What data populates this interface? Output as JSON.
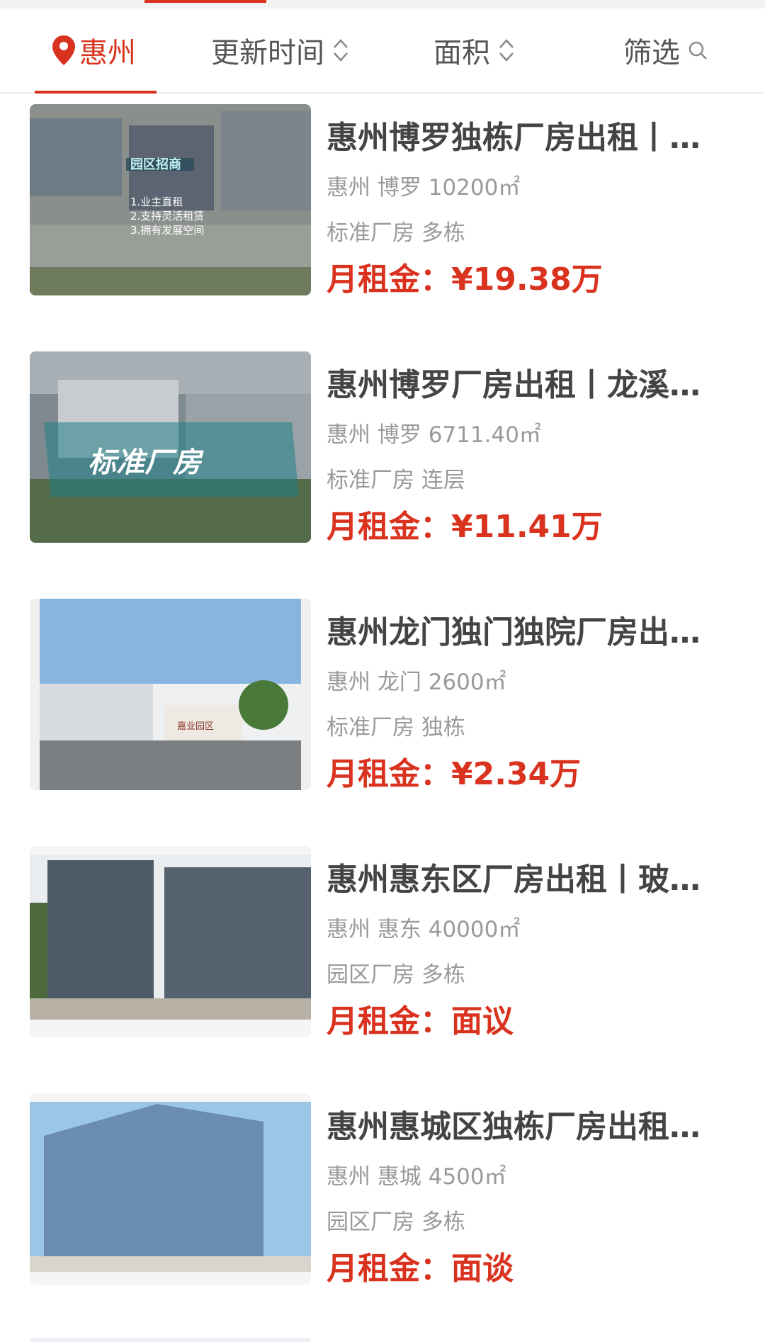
{
  "filter_bar": {
    "city": "惠州",
    "update_time": "更新时间",
    "area": "面积",
    "screen": "筛选"
  },
  "listings": [
    {
      "title": "惠州博罗独栋厂房出租丨…",
      "city": "惠州",
      "district": "博罗",
      "area": "10200㎡",
      "type": "标准厂房 多栋",
      "price_label": "月租金：",
      "price": "¥19.38万",
      "image_text": [
        "园区招商",
        "1.业主直租",
        "2.支持灵活租赁",
        "3.拥有发展空间"
      ]
    },
    {
      "title": "惠州博罗厂房出租丨龙溪…",
      "city": "惠州",
      "district": "博罗",
      "area": "6711.40㎡",
      "type": "标准厂房 连层",
      "price_label": "月租金：",
      "price": "¥11.41万",
      "image_text": [
        "标准厂房"
      ]
    },
    {
      "title": "惠州龙门独门独院厂房出…",
      "city": "惠州",
      "district": "龙门",
      "area": "2600㎡",
      "type": "标准厂房 独栋",
      "price_label": "月租金：",
      "price": "¥2.34万",
      "image_text": [
        "嘉业园区"
      ]
    },
    {
      "title": "惠州惠东区厂房出租丨玻…",
      "city": "惠州",
      "district": "惠东",
      "area": "40000㎡",
      "type": "园区厂房 多栋",
      "price_label": "月租金：",
      "price": "面议",
      "image_text": []
    },
    {
      "title": "惠州惠城区独栋厂房出租…",
      "city": "惠州",
      "district": "惠城",
      "area": "4500㎡",
      "type": "园区厂房 多栋",
      "price_label": "月租金：",
      "price": "面谈",
      "image_text": []
    }
  ],
  "colors": {
    "accent": "#d9331f",
    "title": "#444444",
    "meta": "#9a9a9a"
  }
}
